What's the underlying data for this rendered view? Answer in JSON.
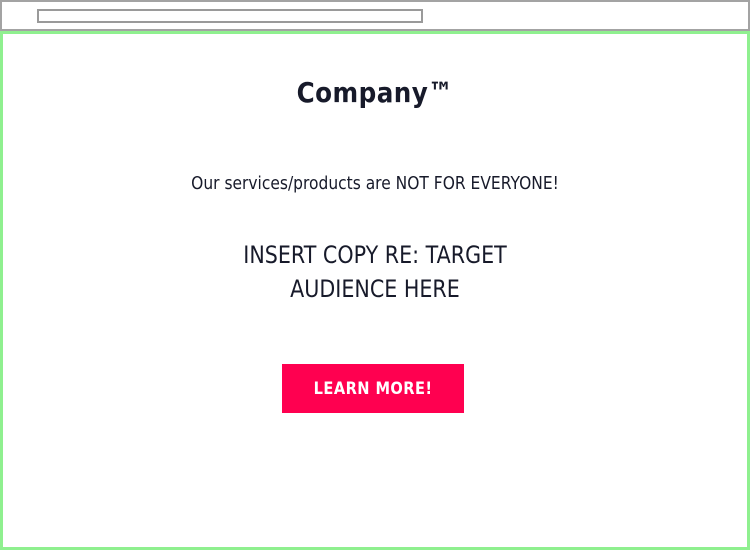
{
  "browser": {
    "address_value": ""
  },
  "page": {
    "brand": "Company™",
    "tagline": "Our services/products are NOT FOR EVERYONE!",
    "headline_line1": "INSERT COPY RE: TARGET",
    "headline_line2": "AUDIENCE HERE",
    "cta_label": "LEARN MORE!"
  },
  "colors": {
    "accent": "#ff0050",
    "text": "#171a2a",
    "frame": "#8ff08f"
  }
}
